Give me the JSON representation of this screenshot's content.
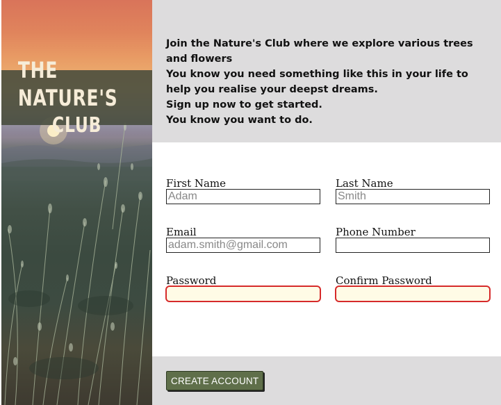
{
  "brand": {
    "line1": "THE NATURE'S",
    "line2": "CLUB"
  },
  "intro": {
    "lines": [
      "Join the Nature's Club where we explore various trees and flowers",
      "You know you need something like this in your life to help you realise your deepst dreams.",
      "Sign up now to get started.",
      "You know you want to do."
    ]
  },
  "form": {
    "first_name": {
      "label": "First Name",
      "placeholder": "Adam",
      "value": ""
    },
    "last_name": {
      "label": "Last Name",
      "placeholder": "Smith",
      "value": ""
    },
    "email": {
      "label": "Email",
      "placeholder": "adam.smith@gmail.com",
      "value": ""
    },
    "phone": {
      "label": "Phone Number",
      "placeholder": "",
      "value": ""
    },
    "password": {
      "label": "Password",
      "placeholder": "",
      "value": "",
      "state": "invalid"
    },
    "confirm_password": {
      "label": "Confirm Password",
      "placeholder": "",
      "value": "",
      "state": "invalid"
    }
  },
  "actions": {
    "create_label": "CREATE ACCOUNT"
  },
  "colors": {
    "panel_gray": "#dddcdd",
    "button_green": "#5f6f4a",
    "invalid_border": "#d62a2a",
    "invalid_fill": "#fffbe6"
  }
}
